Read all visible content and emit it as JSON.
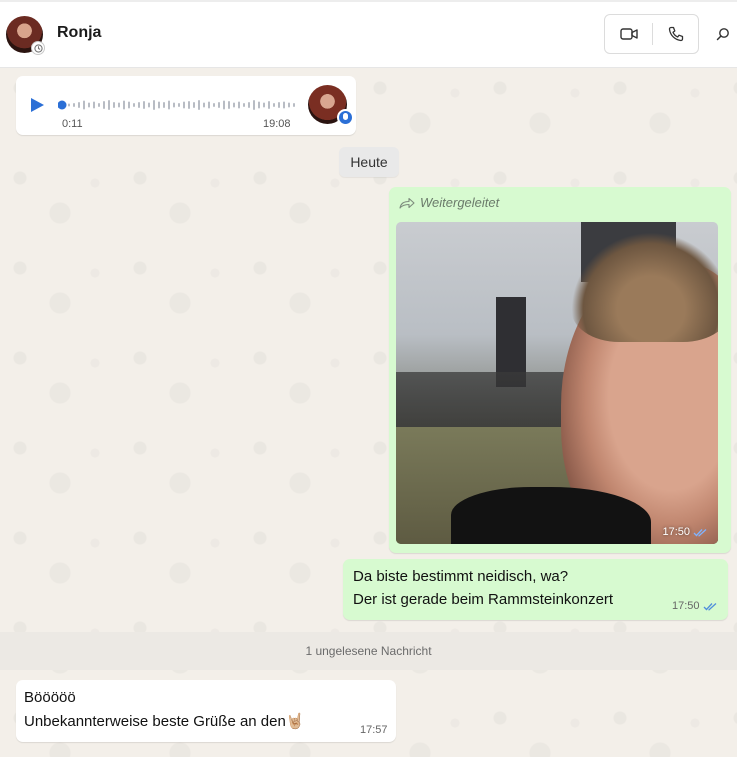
{
  "header": {
    "contact_name": "Ronja",
    "icons": {
      "video": "video-call-icon",
      "phone": "voice-call-icon",
      "search": "search-icon"
    }
  },
  "voice_message": {
    "elapsed": "0:11",
    "time": "19:08",
    "progress": 0.0
  },
  "date_separator": "Heute",
  "photo_message": {
    "forward_label": "Weitergeleitet",
    "time": "17:50"
  },
  "text_message_out": {
    "line1": "Da biste bestimmt neidisch, wa?",
    "line2": "Der ist gerade beim Rammsteinkonzert",
    "time": "17:50"
  },
  "unread_banner": "1 ungelesene Nachricht",
  "text_message_in": {
    "line1": "Bööööö",
    "line2": "Unbekannterweise beste Grüße an den",
    "emoji": "🤘🏼",
    "time": "17:57"
  },
  "colors": {
    "outgoing_bubble": "#d7fad0",
    "incoming_bubble": "#ffffff",
    "accent_blue": "#2b6fd6",
    "read_ticks": "#4f8edc"
  }
}
